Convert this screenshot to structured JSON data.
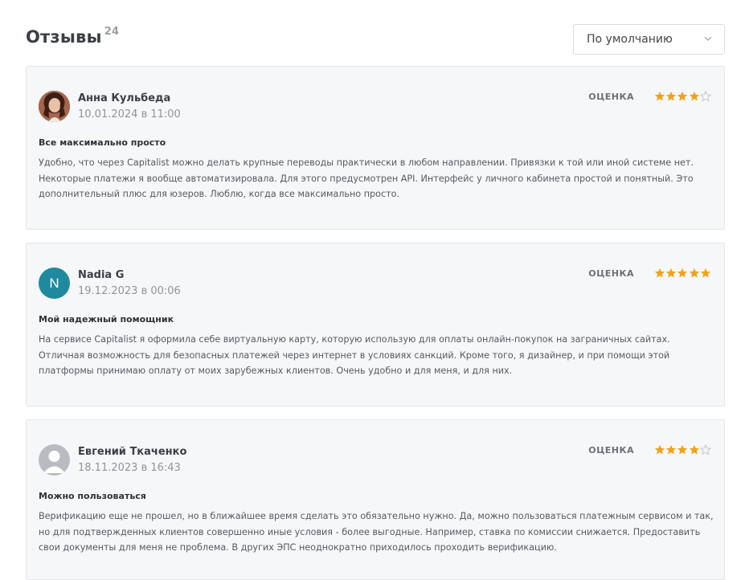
{
  "header": {
    "title": "Отзывы",
    "count": "24",
    "sort": {
      "selected": "По умолчанию"
    }
  },
  "reviews": [
    {
      "author": "Анна Кульбеда",
      "date": "10.01.2024 в 11:00",
      "rating_label": "ОЦЕНКА",
      "rating": 4,
      "title": "Все максимально просто",
      "text": "Удобно, что через Capitalist можно делать крупные переводы практически в любом направлении. Привязки к той или иной системе нет. Некоторые платежи я вообще автоматизировала. Для этого предусмотрен API. Интерфейс у личного кабинета простой и понятный. Это дополнительный плюс для юзеров. Люблю, когда все максимально просто."
    },
    {
      "author": "Nadia G",
      "avatar_letter": "N",
      "date": "19.12.2023 в 00:06",
      "rating_label": "ОЦЕНКА",
      "rating": 5,
      "title": "Мой надежный помощник",
      "text": "На сервисе Capitalist я оформила себе виртуальную карту, которую использую для оплаты онлайн-покупок на заграничных сайтах. Отличная возможность для безопасных платежей через интернет в условиях санкций. Кроме того, я дизайнер, и при помощи этой платформы принимаю оплату от моих зарубежных клиентов. Очень удобно и для меня, и для них."
    },
    {
      "author": "Евгений Ткаченко",
      "date": "18.11.2023 в 16:43",
      "rating_label": "ОЦЕНКА",
      "rating": 4,
      "title": "Можно пользоваться",
      "text": "Верификацию еще не прошел, но в ближайшее время сделать это обязательно нужно. Да, можно пользоваться платежным сервисом и так, но для подтвержденных клиентов совершенно иные условия - более выгодные. Например, ставка по комиссии снижается. Предоставить свои документы для меня не проблема. В других ЭПС неоднократно приходилось проходить верификацию."
    }
  ],
  "colors": {
    "star_filled": "#f0a219",
    "star_empty": "#c4c8cc",
    "card_bg": "#f6f7f9",
    "avatar_letter_bg": "#1f8a9e"
  },
  "icons": {
    "sort_chevron": "chevron-down-icon",
    "star": "star-icon",
    "default_avatar": "user-silhouette-icon"
  }
}
